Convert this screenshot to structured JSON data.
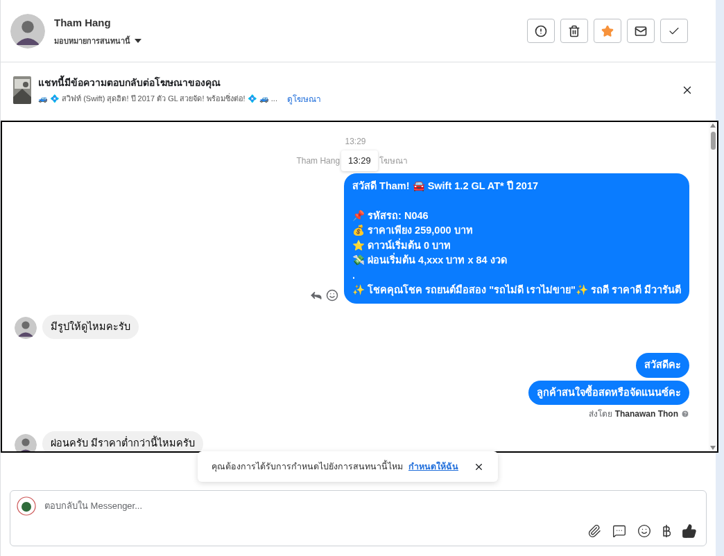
{
  "header": {
    "name": "Tham Hang",
    "assign_label": "มอบหมายการสนทนานี้",
    "actions": [
      {
        "kind": "alert",
        "active": false
      },
      {
        "kind": "trash",
        "active": false
      },
      {
        "kind": "star",
        "active": true
      },
      {
        "kind": "mail",
        "active": false
      },
      {
        "kind": "check",
        "active": false
      }
    ]
  },
  "ad_banner": {
    "title": "แชทนี้มีข้อความตอบกลับต่อโฆษณาของคุณ",
    "snippet": "🚙 💠 สวิฟท์ (Swift) สุดฮิต! ปี 2017 ตัว GL สวยจัด! พร้อมซิ่งต่อ! 💠 🚙 ...",
    "link": "ดูโฆษณา"
  },
  "chat": {
    "timestamp": "13:29",
    "reply_note": {
      "before": "Tham Hang",
      "after": "โฆษณา",
      "tooltip": "13:29"
    },
    "messages": [
      {
        "kind": "outgoing",
        "text": "สวัสดี Tham! 🚘 Swift 1.2 GL AT* ปี 2017\n\n📌 รหัสรถ: N046\n💰 ราคาเพียง 259,000 บาท\n⭐ ดาวน์เริ่มต้น 0 บาท\n💸 ผ่อนเริ่มต้น 4,xxx บาท x 84 งวด\n.\n✨ โชคคุณโชค รถยนต์มือสอง \"รถไม่ดี เราไม่ขาย\"✨ รถดี ราคาดี มีวารันตี",
        "hover_actions": true
      },
      {
        "kind": "incoming",
        "text": "มีรูปให้ดูไหมคะรับ"
      },
      {
        "kind": "outgoing",
        "text": "สวัสดีคะ"
      },
      {
        "kind": "outgoing",
        "text": "ลูกค้าสนใจซื้อสดหรือจัดแนนซ์คะ",
        "sent_by": {
          "prefix": "ส่งโดย",
          "name": "Thanawan Thon"
        }
      },
      {
        "kind": "incoming",
        "text": "ผ่อนครับ มีราคาต่ำกว่านี้ไหมครับ"
      }
    ]
  },
  "toast": {
    "text": "คุณต้องการได้รับการกำหนดไปยังการสนทนานี้ไหม",
    "link": "กำหนดให้ฉัน"
  },
  "composer": {
    "placeholder": "ตอบกลับใน Messenger..."
  }
}
